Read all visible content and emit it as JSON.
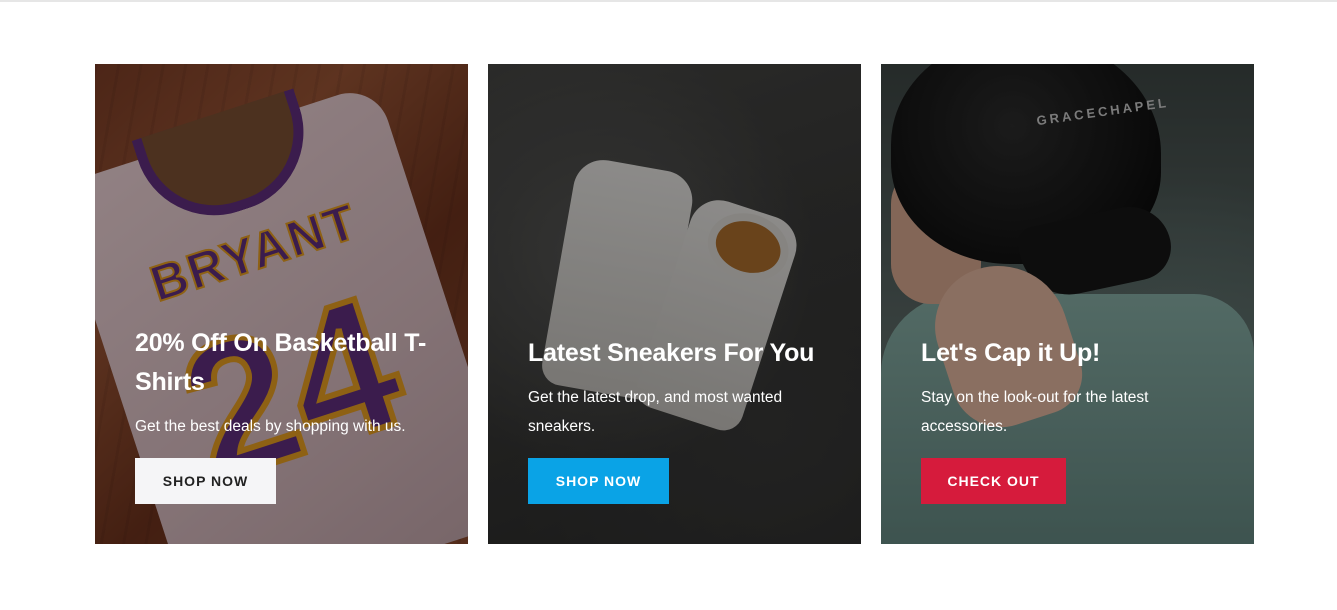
{
  "cards": [
    {
      "title": "20% Off On Basketball T-Shirts",
      "text": "Get the best deals by shopping with us.",
      "button": "SHOP NOW",
      "button_color": "#f5f5f7",
      "image_jersey_name": "BRYANT",
      "image_jersey_number": "24"
    },
    {
      "title": "Latest Sneakers For You",
      "text": "Get the latest drop, and most wanted sneakers.",
      "button": "SHOP NOW",
      "button_color": "#0aa3e6"
    },
    {
      "title": "Let's Cap it Up!",
      "text": "Stay on the look-out for the latest accessories.",
      "button": "CHECK OUT",
      "button_color": "#d61b3c",
      "image_cap_text": "GRACECHAPEL"
    }
  ]
}
